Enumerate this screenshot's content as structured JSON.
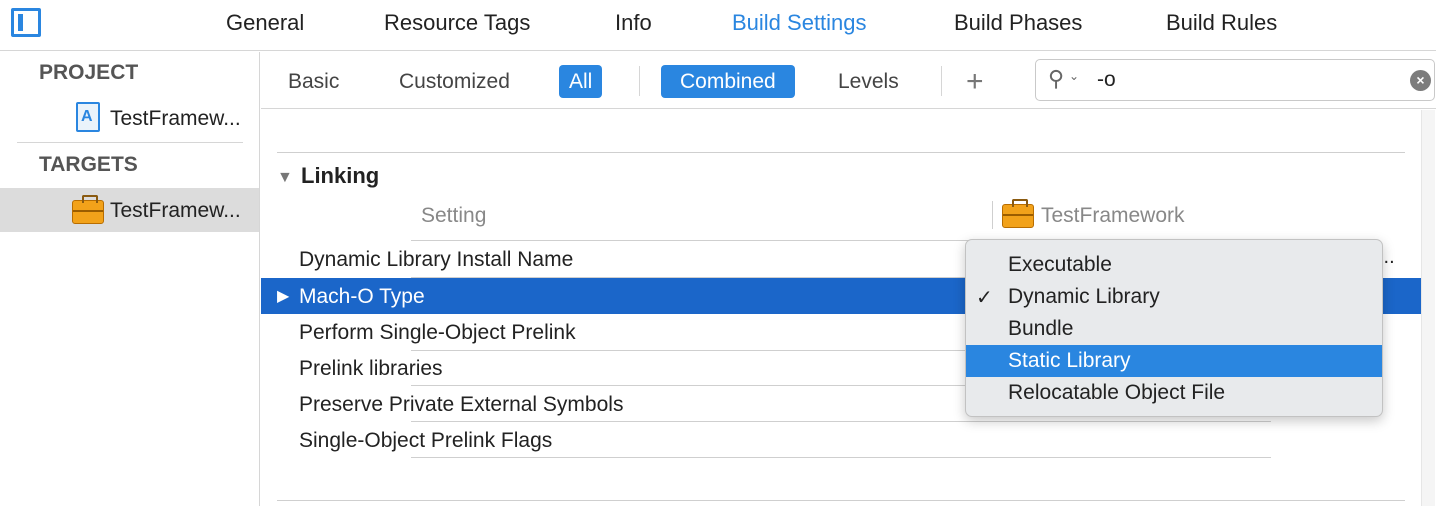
{
  "tabs": {
    "general": "General",
    "resource_tags": "Resource Tags",
    "info": "Info",
    "build_settings": "Build Settings",
    "build_phases": "Build Phases",
    "build_rules": "Build Rules"
  },
  "sidebar": {
    "project_header": "PROJECT",
    "project_item": "TestFramew...",
    "targets_header": "TARGETS",
    "target_item": "TestFramew..."
  },
  "filter": {
    "basic": "Basic",
    "customized": "Customized",
    "all": "All",
    "combined": "Combined",
    "levels": "Levels",
    "add": "+",
    "search_value": "-o"
  },
  "section": {
    "title": "Linking",
    "col_setting": "Setting",
    "col_target": "TestFramework"
  },
  "rows": [
    "Dynamic Library Install Name",
    "Mach-O Type",
    "Perform Single-Object Prelink",
    "Prelink libraries",
    "Preserve Private External Symbols",
    "Single-Object Prelink Flags"
  ],
  "row_overflow": "...",
  "popup": {
    "options": [
      "Executable",
      "Dynamic Library",
      "Bundle",
      "Static Library",
      "Relocatable Object File"
    ],
    "checked": "Dynamic Library",
    "highlighted": "Static Library",
    "check_glyph": "✓"
  },
  "colors": {
    "accent": "#2a86e0",
    "selection": "#1b66c9"
  }
}
